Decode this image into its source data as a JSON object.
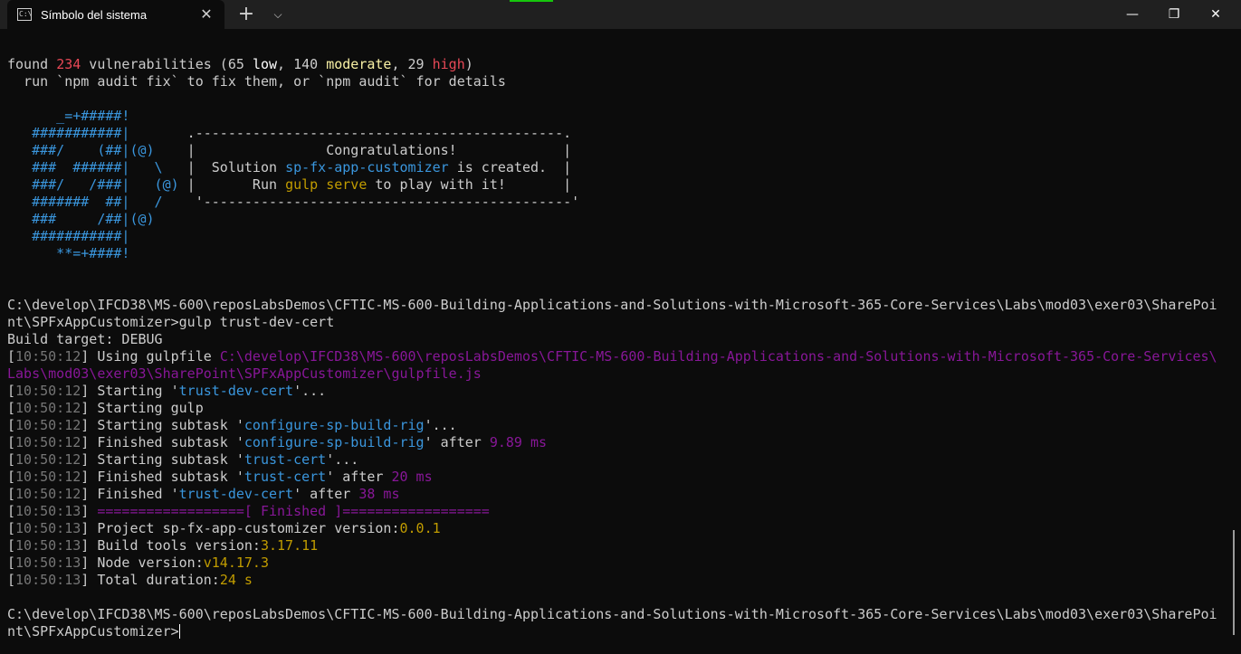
{
  "window": {
    "tab_title": "Símbolo del sistema",
    "tab_icon_text": "C:\\",
    "close_tab_glyph": "✕",
    "new_tab_glyph": "+",
    "dropdown_glyph": "⌵",
    "minimize_glyph": "—",
    "maximize_glyph": "❐",
    "close_window_glyph": "✕"
  },
  "colors": {
    "background": "#0c0c0c",
    "titlebar": "#202020",
    "text": "#cccccc",
    "red": "#e74856",
    "blue": "#3b78ff",
    "cyan": "#3a96dd",
    "orange": "#c19c00",
    "magenta": "#881798",
    "gray": "#767676",
    "yellow": "#f9f1a5"
  },
  "terminal": {
    "lines": [
      [
        {
          "t": "found "
        },
        {
          "t": "234",
          "c": "c-red"
        },
        {
          "t": " vulnerabilities (65 "
        },
        {
          "t": "low",
          "c": "c-low"
        },
        {
          "t": ", 140 "
        },
        {
          "t": "moderate",
          "c": "c-yellow"
        },
        {
          "t": ", 29 "
        },
        {
          "t": "high",
          "c": "c-red"
        },
        {
          "t": ")"
        }
      ],
      [
        {
          "t": "  run `npm audit fix` to fix them, or `npm audit` for details"
        }
      ],
      [
        {
          "t": ""
        }
      ],
      [
        {
          "t": "      _=+#####!",
          "c": "c-cyan"
        }
      ],
      [
        {
          "t": "   ###########|",
          "c": "c-cyan"
        },
        {
          "t": "       .---------------------------------------------."
        }
      ],
      [
        {
          "t": "   ###/    (##|(@)",
          "c": "c-cyan"
        },
        {
          "t": "    |                Congratulations!             |"
        }
      ],
      [
        {
          "t": "   ###  ######|   \\",
          "c": "c-cyan"
        },
        {
          "t": "   |  Solution "
        },
        {
          "t": "sp-fx-app-customizer",
          "c": "c-cyan"
        },
        {
          "t": " is created.  |"
        }
      ],
      [
        {
          "t": "   ###/   /###|   (@)",
          "c": "c-cyan"
        },
        {
          "t": " |       Run "
        },
        {
          "t": "gulp serve",
          "c": "c-orange"
        },
        {
          "t": " to play with it!       |"
        }
      ],
      [
        {
          "t": "   #######  ##|   /",
          "c": "c-cyan"
        },
        {
          "t": "    '---------------------------------------------'"
        }
      ],
      [
        {
          "t": "   ###     /##|(@)",
          "c": "c-cyan"
        }
      ],
      [
        {
          "t": "   ###########|",
          "c": "c-cyan"
        }
      ],
      [
        {
          "t": "      **=+####!",
          "c": "c-cyan"
        }
      ],
      [
        {
          "t": ""
        }
      ],
      [
        {
          "t": ""
        }
      ],
      [
        {
          "t": "C:\\develop\\IFCD38\\MS-600\\reposLabsDemos\\CFTIC-MS-600-Building-Applications-and-Solutions-with-Microsoft-365-Core-Services\\Labs\\mod03\\exer03\\SharePoi"
        }
      ],
      [
        {
          "t": "nt\\SPFxAppCustomizer>gulp trust-dev-cert"
        }
      ],
      [
        {
          "t": "Build target: DEBUG"
        }
      ],
      [
        {
          "t": "["
        },
        {
          "t": "10:50:12",
          "c": "c-gray"
        },
        {
          "t": "] Using gulpfile "
        },
        {
          "t": "C:\\develop\\IFCD38\\MS-600\\reposLabsDemos\\CFTIC-MS-600-Building-Applications-and-Solutions-with-Microsoft-365-Core-Services\\",
          "c": "c-magenta"
        }
      ],
      [
        {
          "t": "Labs\\mod03\\exer03\\SharePoint\\SPFxAppCustomizer\\gulpfile.js",
          "c": "c-magenta"
        }
      ],
      [
        {
          "t": "["
        },
        {
          "t": "10:50:12",
          "c": "c-gray"
        },
        {
          "t": "] Starting '"
        },
        {
          "t": "trust-dev-cert",
          "c": "c-cyan"
        },
        {
          "t": "'..."
        }
      ],
      [
        {
          "t": "["
        },
        {
          "t": "10:50:12",
          "c": "c-gray"
        },
        {
          "t": "] Starting gulp"
        }
      ],
      [
        {
          "t": "["
        },
        {
          "t": "10:50:12",
          "c": "c-gray"
        },
        {
          "t": "] Starting subtask '"
        },
        {
          "t": "configure-sp-build-rig",
          "c": "c-cyan"
        },
        {
          "t": "'..."
        }
      ],
      [
        {
          "t": "["
        },
        {
          "t": "10:50:12",
          "c": "c-gray"
        },
        {
          "t": "] Finished subtask '"
        },
        {
          "t": "configure-sp-build-rig",
          "c": "c-cyan"
        },
        {
          "t": "' after "
        },
        {
          "t": "9.89 ms",
          "c": "c-magenta"
        }
      ],
      [
        {
          "t": "["
        },
        {
          "t": "10:50:12",
          "c": "c-gray"
        },
        {
          "t": "] Starting subtask '"
        },
        {
          "t": "trust-cert",
          "c": "c-cyan"
        },
        {
          "t": "'..."
        }
      ],
      [
        {
          "t": "["
        },
        {
          "t": "10:50:12",
          "c": "c-gray"
        },
        {
          "t": "] Finished subtask '"
        },
        {
          "t": "trust-cert",
          "c": "c-cyan"
        },
        {
          "t": "' after "
        },
        {
          "t": "20 ms",
          "c": "c-magenta"
        }
      ],
      [
        {
          "t": "["
        },
        {
          "t": "10:50:12",
          "c": "c-gray"
        },
        {
          "t": "] Finished '"
        },
        {
          "t": "trust-dev-cert",
          "c": "c-cyan"
        },
        {
          "t": "' after "
        },
        {
          "t": "38 ms",
          "c": "c-magenta"
        }
      ],
      [
        {
          "t": "["
        },
        {
          "t": "10:50:13",
          "c": "c-gray"
        },
        {
          "t": "] "
        },
        {
          "t": "==================[ Finished ]==================",
          "c": "c-magenta"
        }
      ],
      [
        {
          "t": "["
        },
        {
          "t": "10:50:13",
          "c": "c-gray"
        },
        {
          "t": "] Project sp-fx-app-customizer version:"
        },
        {
          "t": "0.0.1",
          "c": "c-orange"
        }
      ],
      [
        {
          "t": "["
        },
        {
          "t": "10:50:13",
          "c": "c-gray"
        },
        {
          "t": "] Build tools version:"
        },
        {
          "t": "3.17.11",
          "c": "c-orange"
        }
      ],
      [
        {
          "t": "["
        },
        {
          "t": "10:50:13",
          "c": "c-gray"
        },
        {
          "t": "] Node version:"
        },
        {
          "t": "v14.17.3",
          "c": "c-orange"
        }
      ],
      [
        {
          "t": "["
        },
        {
          "t": "10:50:13",
          "c": "c-gray"
        },
        {
          "t": "] Total duration:"
        },
        {
          "t": "24 s",
          "c": "c-orange"
        }
      ],
      [
        {
          "t": ""
        }
      ],
      [
        {
          "t": "C:\\develop\\IFCD38\\MS-600\\reposLabsDemos\\CFTIC-MS-600-Building-Applications-and-Solutions-with-Microsoft-365-Core-Services\\Labs\\mod03\\exer03\\SharePoi"
        }
      ],
      [
        {
          "t": "nt\\SPFxAppCustomizer>"
        }
      ]
    ]
  }
}
